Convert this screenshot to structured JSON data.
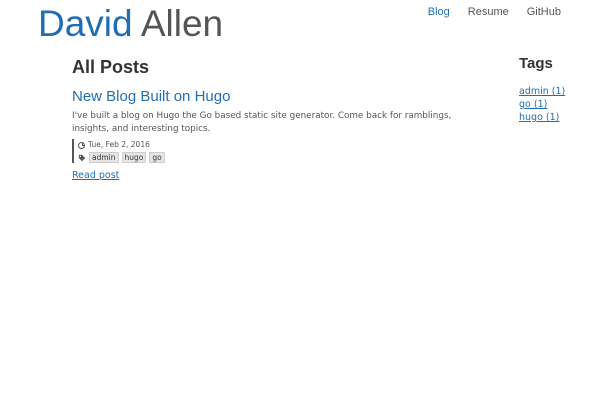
{
  "header": {
    "brand_first": "David",
    "brand_last": "Allen"
  },
  "nav": {
    "items": [
      {
        "label": "Blog",
        "active": true
      },
      {
        "label": "Resume",
        "active": false
      },
      {
        "label": "GitHub",
        "active": false
      }
    ]
  },
  "main": {
    "page_title": "All Posts",
    "post": {
      "title": "New Blog Built on Hugo",
      "summary": "I've built a blog on Hugo the Go based static site generator. Come back for ramblings, insights, and interesting topics.",
      "date": "Tue, Feb 2, 2016",
      "tags": [
        "admin",
        "hugo",
        "go"
      ],
      "read_more": "Read post"
    }
  },
  "sidebar": {
    "heading": "Tags",
    "tags": [
      {
        "label": "admin (1)"
      },
      {
        "label": "go (1)"
      },
      {
        "label": "hugo (1)"
      }
    ]
  },
  "colors": {
    "link": "#1f6eb3",
    "text": "#333333",
    "muted": "#555555"
  },
  "icons": {
    "date": "clock-icon",
    "tags": "tag-icon"
  }
}
